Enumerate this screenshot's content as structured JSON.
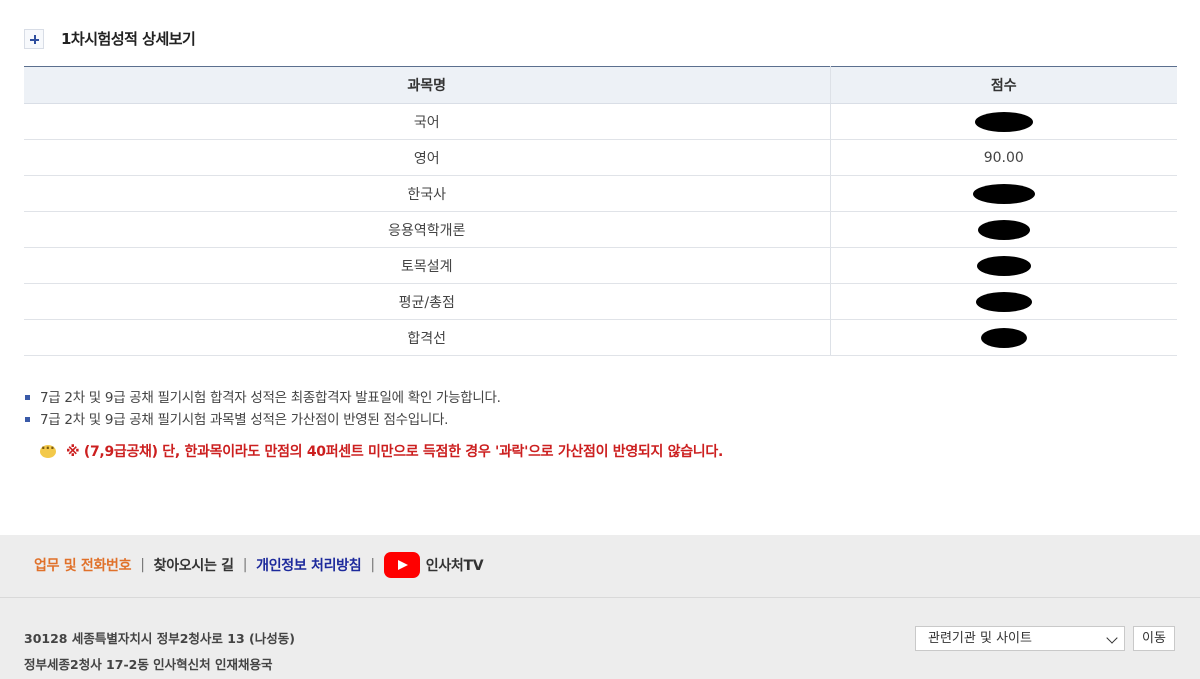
{
  "section": {
    "title": "1차시험성적 상세보기"
  },
  "table": {
    "headers": {
      "subject": "과목명",
      "score": "점수"
    },
    "rows": [
      {
        "subject": "국어",
        "score": "",
        "redacted": true
      },
      {
        "subject": "영어",
        "score": "90.00",
        "redacted": false
      },
      {
        "subject": "한국사",
        "score": "",
        "redacted": true
      },
      {
        "subject": "응용역학개론",
        "score": "",
        "redacted": true
      },
      {
        "subject": "토목설계",
        "score": "",
        "redacted": true
      },
      {
        "subject": "평균/총점",
        "score": "",
        "redacted": true
      },
      {
        "subject": "합격선",
        "score": "",
        "redacted": true
      }
    ]
  },
  "notes": [
    "7급 2차 및 9급 공채 필기시험 합격자 성적은 최종합격자 발표일에 확인 가능합니다.",
    "7급 2차 및 9급 공채 필기시험 과목별 성적은 가산점이 반영된 점수입니다."
  ],
  "warning": "※ (7,9급공채) 단, 한과목이라도 만점의 40퍼센트 미만으로 득점한 경우 '과락'으로 가산점이 반영되지 않습니다.",
  "footer": {
    "links": {
      "work_phone": "업무 및 전화번호",
      "directions": "찾아오시는 길",
      "privacy": "개인정보 처리방침",
      "youtube": "인사처TV"
    },
    "separator": "|",
    "address1": "30128 세종특별자치시 정부2청사로 13 (나성동)",
    "address2": "정부세종2청사 17-2동 인사혁신처 인재채용국",
    "site_select": "관련기관 및 사이트",
    "go_button": "이동"
  },
  "colors": {
    "header_bg": "#edf1f6",
    "warning_red": "#cc1f1f",
    "link_orange": "#e0712a",
    "link_blue": "#1d2a9c",
    "youtube_red": "#ff0000"
  },
  "icons": {
    "section_toggle": "plus-icon",
    "warning": "speech-bubble-icon",
    "youtube": "youtube-icon",
    "select": "chevron-down-icon"
  }
}
